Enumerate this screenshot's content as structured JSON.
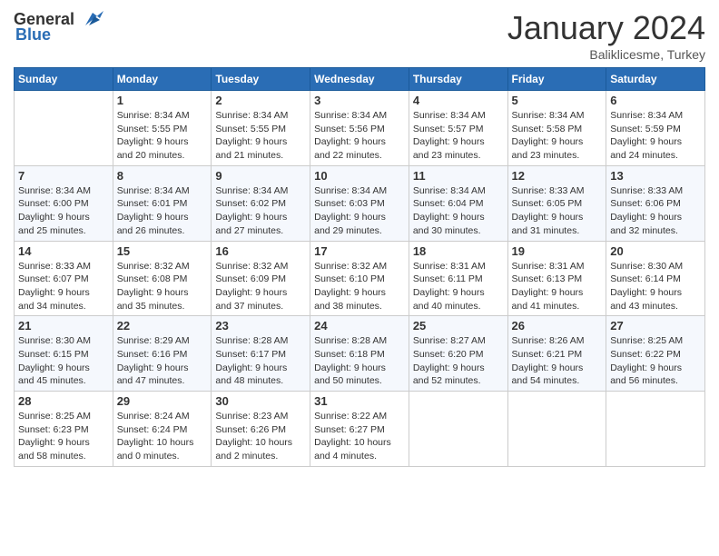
{
  "header": {
    "logo_general": "General",
    "logo_blue": "Blue",
    "title": "January 2024",
    "location": "Baliklicesme, Turkey"
  },
  "weekdays": [
    "Sunday",
    "Monday",
    "Tuesday",
    "Wednesday",
    "Thursday",
    "Friday",
    "Saturday"
  ],
  "weeks": [
    [
      {
        "day": "",
        "info": ""
      },
      {
        "day": "1",
        "info": "Sunrise: 8:34 AM\nSunset: 5:55 PM\nDaylight: 9 hours\nand 20 minutes."
      },
      {
        "day": "2",
        "info": "Sunrise: 8:34 AM\nSunset: 5:55 PM\nDaylight: 9 hours\nand 21 minutes."
      },
      {
        "day": "3",
        "info": "Sunrise: 8:34 AM\nSunset: 5:56 PM\nDaylight: 9 hours\nand 22 minutes."
      },
      {
        "day": "4",
        "info": "Sunrise: 8:34 AM\nSunset: 5:57 PM\nDaylight: 9 hours\nand 23 minutes."
      },
      {
        "day": "5",
        "info": "Sunrise: 8:34 AM\nSunset: 5:58 PM\nDaylight: 9 hours\nand 23 minutes."
      },
      {
        "day": "6",
        "info": "Sunrise: 8:34 AM\nSunset: 5:59 PM\nDaylight: 9 hours\nand 24 minutes."
      }
    ],
    [
      {
        "day": "7",
        "info": "Sunrise: 8:34 AM\nSunset: 6:00 PM\nDaylight: 9 hours\nand 25 minutes."
      },
      {
        "day": "8",
        "info": "Sunrise: 8:34 AM\nSunset: 6:01 PM\nDaylight: 9 hours\nand 26 minutes."
      },
      {
        "day": "9",
        "info": "Sunrise: 8:34 AM\nSunset: 6:02 PM\nDaylight: 9 hours\nand 27 minutes."
      },
      {
        "day": "10",
        "info": "Sunrise: 8:34 AM\nSunset: 6:03 PM\nDaylight: 9 hours\nand 29 minutes."
      },
      {
        "day": "11",
        "info": "Sunrise: 8:34 AM\nSunset: 6:04 PM\nDaylight: 9 hours\nand 30 minutes."
      },
      {
        "day": "12",
        "info": "Sunrise: 8:33 AM\nSunset: 6:05 PM\nDaylight: 9 hours\nand 31 minutes."
      },
      {
        "day": "13",
        "info": "Sunrise: 8:33 AM\nSunset: 6:06 PM\nDaylight: 9 hours\nand 32 minutes."
      }
    ],
    [
      {
        "day": "14",
        "info": "Sunrise: 8:33 AM\nSunset: 6:07 PM\nDaylight: 9 hours\nand 34 minutes."
      },
      {
        "day": "15",
        "info": "Sunrise: 8:32 AM\nSunset: 6:08 PM\nDaylight: 9 hours\nand 35 minutes."
      },
      {
        "day": "16",
        "info": "Sunrise: 8:32 AM\nSunset: 6:09 PM\nDaylight: 9 hours\nand 37 minutes."
      },
      {
        "day": "17",
        "info": "Sunrise: 8:32 AM\nSunset: 6:10 PM\nDaylight: 9 hours\nand 38 minutes."
      },
      {
        "day": "18",
        "info": "Sunrise: 8:31 AM\nSunset: 6:11 PM\nDaylight: 9 hours\nand 40 minutes."
      },
      {
        "day": "19",
        "info": "Sunrise: 8:31 AM\nSunset: 6:13 PM\nDaylight: 9 hours\nand 41 minutes."
      },
      {
        "day": "20",
        "info": "Sunrise: 8:30 AM\nSunset: 6:14 PM\nDaylight: 9 hours\nand 43 minutes."
      }
    ],
    [
      {
        "day": "21",
        "info": "Sunrise: 8:30 AM\nSunset: 6:15 PM\nDaylight: 9 hours\nand 45 minutes."
      },
      {
        "day": "22",
        "info": "Sunrise: 8:29 AM\nSunset: 6:16 PM\nDaylight: 9 hours\nand 47 minutes."
      },
      {
        "day": "23",
        "info": "Sunrise: 8:28 AM\nSunset: 6:17 PM\nDaylight: 9 hours\nand 48 minutes."
      },
      {
        "day": "24",
        "info": "Sunrise: 8:28 AM\nSunset: 6:18 PM\nDaylight: 9 hours\nand 50 minutes."
      },
      {
        "day": "25",
        "info": "Sunrise: 8:27 AM\nSunset: 6:20 PM\nDaylight: 9 hours\nand 52 minutes."
      },
      {
        "day": "26",
        "info": "Sunrise: 8:26 AM\nSunset: 6:21 PM\nDaylight: 9 hours\nand 54 minutes."
      },
      {
        "day": "27",
        "info": "Sunrise: 8:25 AM\nSunset: 6:22 PM\nDaylight: 9 hours\nand 56 minutes."
      }
    ],
    [
      {
        "day": "28",
        "info": "Sunrise: 8:25 AM\nSunset: 6:23 PM\nDaylight: 9 hours\nand 58 minutes."
      },
      {
        "day": "29",
        "info": "Sunrise: 8:24 AM\nSunset: 6:24 PM\nDaylight: 10 hours\nand 0 minutes."
      },
      {
        "day": "30",
        "info": "Sunrise: 8:23 AM\nSunset: 6:26 PM\nDaylight: 10 hours\nand 2 minutes."
      },
      {
        "day": "31",
        "info": "Sunrise: 8:22 AM\nSunset: 6:27 PM\nDaylight: 10 hours\nand 4 minutes."
      },
      {
        "day": "",
        "info": ""
      },
      {
        "day": "",
        "info": ""
      },
      {
        "day": "",
        "info": ""
      }
    ]
  ]
}
